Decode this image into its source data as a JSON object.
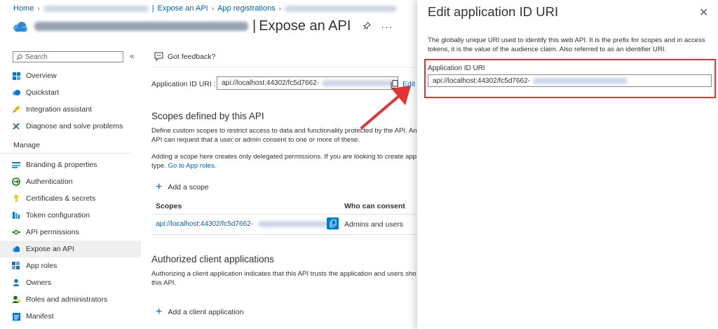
{
  "breadcrumb": {
    "home": "Home",
    "expose_api": "Expose an API",
    "app_registrations": "App registrations"
  },
  "header": {
    "title": "Expose an API",
    "more": "···"
  },
  "sidebar": {
    "search_placeholder": "Search",
    "collapse": "«",
    "items_top": [
      {
        "label": "Overview",
        "icon": "overview-icon"
      },
      {
        "label": "Quickstart",
        "icon": "quickstart-icon"
      },
      {
        "label": "Integration assistant",
        "icon": "rocket-icon"
      },
      {
        "label": "Diagnose and solve problems",
        "icon": "wrench-icon"
      }
    ],
    "manage_label": "Manage",
    "items_manage": [
      {
        "label": "Branding & properties",
        "icon": "branding-icon"
      },
      {
        "label": "Authentication",
        "icon": "authentication-icon"
      },
      {
        "label": "Certificates & secrets",
        "icon": "key-icon"
      },
      {
        "label": "Token configuration",
        "icon": "token-icon"
      },
      {
        "label": "API permissions",
        "icon": "api-permissions-icon"
      },
      {
        "label": "Expose an API",
        "icon": "cloud-icon",
        "active": true
      },
      {
        "label": "App roles",
        "icon": "app-roles-icon"
      },
      {
        "label": "Owners",
        "icon": "owners-icon"
      },
      {
        "label": "Roles and administrators",
        "icon": "roles-icon"
      },
      {
        "label": "Manifest",
        "icon": "manifest-icon"
      }
    ]
  },
  "main": {
    "feedback": "Got feedback?",
    "app_id_uri_label": "Application ID URI :",
    "app_id_uri_value": "api://localhost:44302/fc5d7662-",
    "edit": "Edit",
    "scopes_heading": "Scopes defined by this API",
    "scopes_desc": "Define custom scopes to restrict access to data and functionality protected by the API. An API can request that a user or admin consent to one or more of these.",
    "scopes_note": "Adding a scope here creates only delegated permissions. If you are looking to create app type.",
    "goto_app_roles": "Go to App roles.",
    "add_scope": "Add a scope",
    "table": {
      "headers": [
        "Scopes",
        "Who can consent"
      ],
      "rows": [
        {
          "scope": "api://localhost:44302/fc5d7662-",
          "consent": "Admins and users"
        }
      ]
    },
    "authorized_heading": "Authorized client applications",
    "authorized_desc": "Authorizing a client application indicates that this API trusts the application and users sho this API.",
    "add_client": "Add a client application"
  },
  "panel": {
    "title": "Edit application ID URI",
    "close": "✕",
    "description": "The globally unique URI used to identify this web API. It is the prefix for scopes and in access tokens, it is the value of the audience claim. Also referred to as an identifier URI.",
    "field_label": "Application ID URI",
    "field_value": "api://localhost:44302/fc5d7662-"
  },
  "colors": {
    "link": "#0062b8",
    "accent": "#0078d4",
    "highlight": "#e23434"
  }
}
